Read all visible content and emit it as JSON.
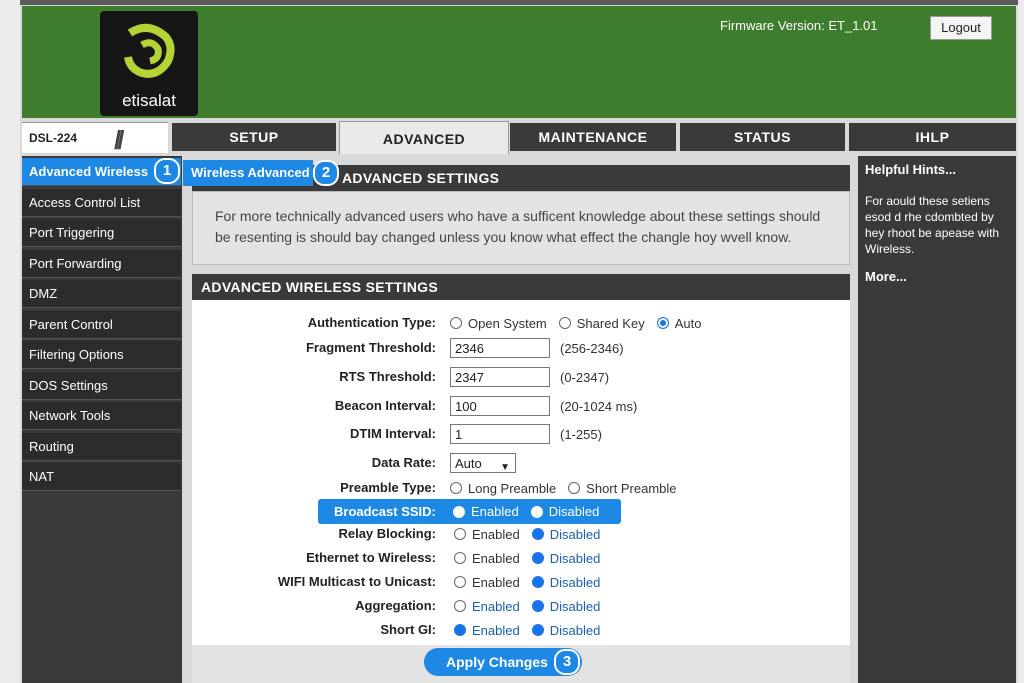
{
  "header": {
    "brand": "etisalat",
    "firmware": "Firmware Version: ET_1.01",
    "logout_label": "Logout"
  },
  "nav": {
    "model": "DSL-224",
    "tabs": [
      {
        "label": "SETUP",
        "active": false
      },
      {
        "label": "ADVANCED",
        "active": true
      },
      {
        "label": "MAINTENANCE",
        "active": false
      },
      {
        "label": "STATUS",
        "active": false
      },
      {
        "label": "IHLP",
        "active": false
      }
    ]
  },
  "sidebar": {
    "items": [
      {
        "label": "Advanced Wireless",
        "active": true
      },
      {
        "label": "Access Control List"
      },
      {
        "label": "Port Triggering"
      },
      {
        "label": "Port Forwarding"
      },
      {
        "label": "DMZ"
      },
      {
        "label": "Parent Control"
      },
      {
        "label": "Filtering Options"
      },
      {
        "label": "DOS Settings"
      },
      {
        "label": "Network Tools"
      },
      {
        "label": "Routing"
      },
      {
        "label": "NAT"
      }
    ]
  },
  "breadcrumb": {
    "label": "Wireless Advanced"
  },
  "badges": {
    "one": "1",
    "two": "2",
    "three": "3"
  },
  "advanced_settings": {
    "title": "ADVANCED SETTINGS",
    "title_visible": "ADVANCED SETTINGS",
    "intro": "For more technically advanced users who have a sufficent knowledge about these settings should be resenting is should bay changed unless you know what effect the changle hoy wvell know."
  },
  "wireless": {
    "title": "ADVANCED WIRELESS SETTINGS",
    "auth": {
      "label": "Authentication Type:",
      "options": [
        "Open System",
        "Shared Key",
        "Auto"
      ],
      "selected": "Auto"
    },
    "fragment": {
      "label": "Fragment Threshold:",
      "value": "2346",
      "hint": "(256-2346)"
    },
    "rts": {
      "label": "RTS Threshold:",
      "value": "2347",
      "hint": "(0-2347)"
    },
    "beacon": {
      "label": "Beacon Interval:",
      "value": "100",
      "hint": "(20-1024 ms)"
    },
    "dtim": {
      "label": "DTIM Interval:",
      "value": "1",
      "hint": "(1-255)"
    },
    "data_rate": {
      "label": "Data Rate:",
      "value": "Auto"
    },
    "preamble": {
      "label": "Preamble Type:",
      "options": [
        "Long Preamble",
        "Short Preamble"
      ]
    },
    "broadcast_ssid": {
      "label": "Broadcast SSID:",
      "enabled": "Enabled",
      "disabled": "Disabled"
    },
    "relay": {
      "label": "Relay Blocking:",
      "enabled": "Enabled",
      "disabled": "Disabled",
      "selected": "Disabled"
    },
    "eth_wireless": {
      "label": "Ethernet to Wireless:",
      "enabled": "Enabled",
      "disabled": "Disabled",
      "selected": "Disabled"
    },
    "multicast": {
      "label": "WIFI Multicast to Unicast:",
      "enabled": "Enabled",
      "disabled": "Disabled",
      "selected": "Disabled"
    },
    "aggregation": {
      "label": "Aggregation:",
      "enabled": "Enabled",
      "disabled": "Disabled",
      "selected": "Disabled"
    },
    "short_gi": {
      "label": "Short GI:",
      "enabled": "Enabled",
      "disabled": "Disabled",
      "selected": "both"
    },
    "apply_label": "Apply Changes"
  },
  "hints": {
    "title": "Helpful Hints...",
    "body": "For aould these setiens esod d rhe cdombted by hey rhoot be apease with Wireless.",
    "more": "More..."
  },
  "colors": {
    "header_green": "#3f7d2e",
    "accent_blue": "#1e88e5",
    "panel_dark": "#3a3a3a"
  }
}
